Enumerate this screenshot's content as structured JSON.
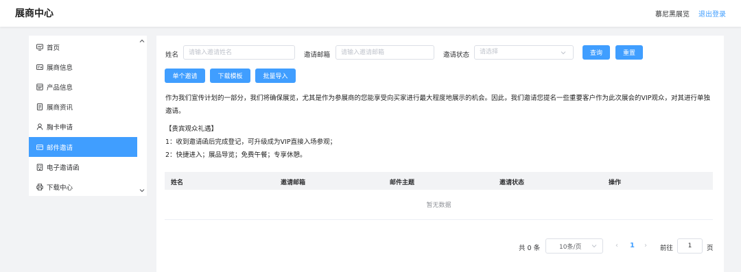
{
  "header": {
    "title": "展商中心",
    "exhibition_name": "慕尼黑展览",
    "logout_label": "退出登录"
  },
  "sidebar": {
    "items": [
      {
        "label": "首页",
        "icon": "monitor-icon",
        "active": false
      },
      {
        "label": "展商信息",
        "icon": "id-card-icon",
        "active": false
      },
      {
        "label": "产品信息",
        "icon": "product-icon",
        "active": false
      },
      {
        "label": "展商资讯",
        "icon": "document-icon",
        "active": false
      },
      {
        "label": "胸卡申请",
        "icon": "user-icon",
        "active": false
      },
      {
        "label": "邮件邀请",
        "icon": "mail-icon",
        "active": true
      },
      {
        "label": "电子邀请函",
        "icon": "building-icon",
        "active": false
      },
      {
        "label": "下载中心",
        "icon": "printer-icon",
        "active": false
      }
    ]
  },
  "search": {
    "name_label": "姓名",
    "name_placeholder": "请输入邀请姓名",
    "email_label": "邀请邮箱",
    "email_placeholder": "请输入邀请邮箱",
    "status_label": "邀请状态",
    "status_placeholder": "请选择",
    "query_label": "查询",
    "reset_label": "重置"
  },
  "actions": {
    "single_invite": "单个邀请",
    "download_template": "下载模板",
    "batch_import": "批量导入"
  },
  "description": {
    "paragraph": "作为我们宣传计划的一部分，我们将确保展览，尤其是作为参展商的您能享受向买家进行最大程度地展示的机会。因此，我们邀请您提名一些重要客户作为此次展会的VIP观众，对其进行单独邀请。",
    "benefits_title": "【贵宾观众礼遇】",
    "benefit_1": "1：收到邀请函后完成登记，可升级成为VIP直接入场参观；",
    "benefit_2": "2：快捷进入；展品导览；免费午餐；专享休憩。"
  },
  "table": {
    "columns": [
      "姓名",
      "邀请邮箱",
      "邮件主题",
      "邀请状态",
      "操作"
    ],
    "rows": [],
    "empty_text": "暂无数据"
  },
  "pagination": {
    "total_text": "共 0 条",
    "page_size": "10条/页",
    "current_page": "1",
    "goto_label": "前往",
    "goto_value": "1",
    "page_suffix": "页"
  },
  "colors": {
    "primary": "#409eff",
    "background": "#f2f3f5"
  }
}
